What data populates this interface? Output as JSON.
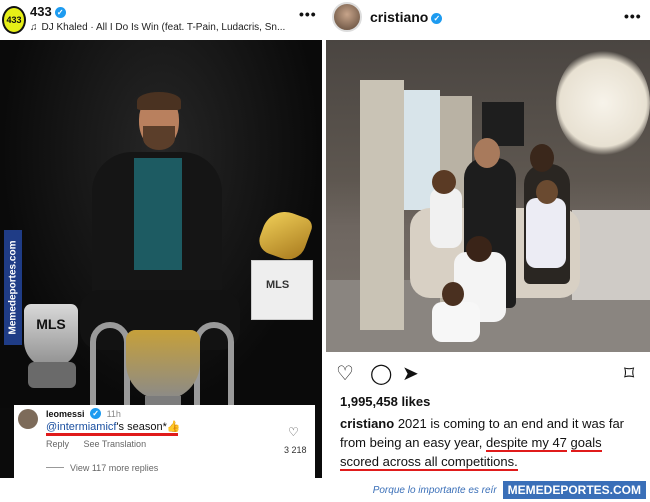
{
  "left_post": {
    "username": "433",
    "avatar_text": "433",
    "music": "DJ Khaled · All I Do Is Win (feat. T-Pain, Ludacris, Sn...",
    "more": "•••",
    "watermark": "Memedeportes.com",
    "award_box_text": "MLS",
    "trophy_text": "MLS",
    "comment": {
      "user": "leomessi",
      "time": "11h",
      "mention": "@intermiamicf",
      "text_rest": "'s season*",
      "emoji": "👍",
      "reply": "Reply",
      "translate": "See Translation",
      "likes": "3 218",
      "view_replies": "View 117 more replies"
    }
  },
  "right_post": {
    "username": "cristiano",
    "more": "•••",
    "likes": "1,995,458 likes",
    "caption": {
      "user": "cristiano",
      "part1": "2021 is coming to an end and it was far from being an easy year,",
      "underlined1": "despite my 47",
      "underlined2": "goals scored across all competitions."
    }
  },
  "icons": {
    "heart": "heart-icon",
    "comment": "comment-icon",
    "share": "share-icon",
    "bookmark": "bookmark-icon"
  },
  "footer": {
    "slogan": "Porque lo importante es reír",
    "brand": "MEMEDEPORTES.COM"
  },
  "colors": {
    "accent_yellow": "#e6ef17",
    "verified_blue": "#1d9bf0",
    "underline_red": "#e01b1b",
    "brand_blue": "#3a6fb8"
  }
}
